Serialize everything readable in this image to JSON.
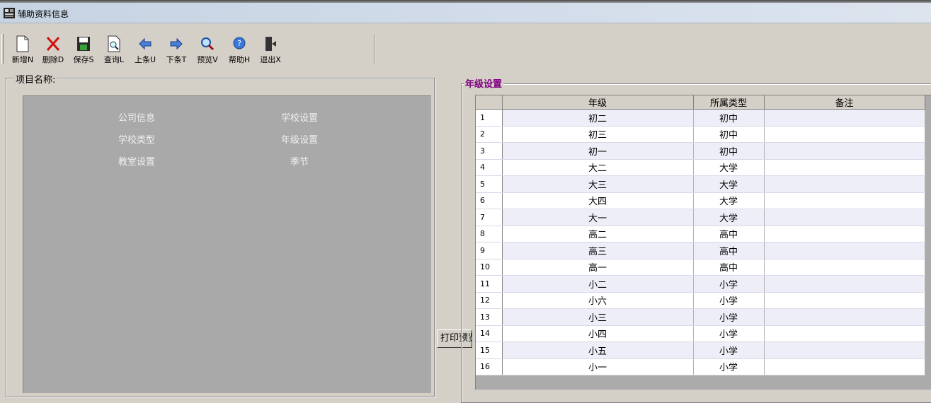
{
  "window": {
    "title": "辅助资料信息"
  },
  "toolbar": {
    "new": "新增N",
    "delete": "删除D",
    "save": "保存S",
    "query": "查询L",
    "prev": "上条U",
    "next": "下条T",
    "preview": "预览V",
    "help": "帮助H",
    "exit": "退出X"
  },
  "left_panel": {
    "label": "项目名称:",
    "items": [
      "公司信息",
      "学校设置",
      "学校类型",
      "年级设置",
      "教室设置",
      "季节"
    ]
  },
  "print_preview_label": "打印预览",
  "grade_panel": {
    "label": "年级设置",
    "columns": [
      "年级",
      "所属类型",
      "备注"
    ],
    "rows": [
      {
        "no": "1",
        "grade": "初二",
        "type": "初中",
        "note": ""
      },
      {
        "no": "2",
        "grade": "初三",
        "type": "初中",
        "note": ""
      },
      {
        "no": "3",
        "grade": "初一",
        "type": "初中",
        "note": ""
      },
      {
        "no": "4",
        "grade": "大二",
        "type": "大学",
        "note": ""
      },
      {
        "no": "5",
        "grade": "大三",
        "type": "大学",
        "note": ""
      },
      {
        "no": "6",
        "grade": "大四",
        "type": "大学",
        "note": ""
      },
      {
        "no": "7",
        "grade": "大一",
        "type": "大学",
        "note": ""
      },
      {
        "no": "8",
        "grade": "高二",
        "type": "高中",
        "note": ""
      },
      {
        "no": "9",
        "grade": "高三",
        "type": "高中",
        "note": ""
      },
      {
        "no": "10",
        "grade": "高一",
        "type": "高中",
        "note": ""
      },
      {
        "no": "11",
        "grade": "小二",
        "type": "小学",
        "note": ""
      },
      {
        "no": "12",
        "grade": "小六",
        "type": "小学",
        "note": ""
      },
      {
        "no": "13",
        "grade": "小三",
        "type": "小学",
        "note": ""
      },
      {
        "no": "14",
        "grade": "小四",
        "type": "小学",
        "note": ""
      },
      {
        "no": "15",
        "grade": "小五",
        "type": "小学",
        "note": ""
      },
      {
        "no": "16",
        "grade": "小一",
        "type": "小学",
        "note": ""
      }
    ]
  },
  "colors": {
    "accent_label": "#800080",
    "list_bg": "#a9a9a9",
    "alt_row": "#eeeef8"
  }
}
